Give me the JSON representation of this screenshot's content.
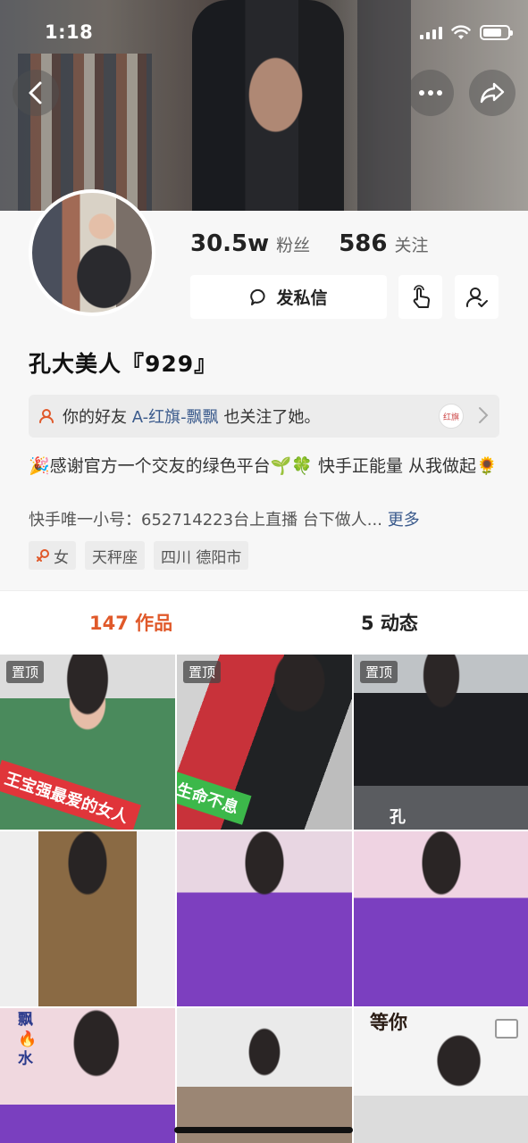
{
  "status_bar": {
    "time": "1:18"
  },
  "profile": {
    "followers_count": "30.5w",
    "followers_label": "粉丝",
    "following_count": "586",
    "following_label": "关注",
    "message_button": "发私信",
    "name": "孔大美人『929』",
    "friend_notice": {
      "prefix": "你的好友",
      "friend_name": "A-红旗-飘飘",
      "suffix": "也关注了她。",
      "badge_text": "红旗"
    },
    "bio_line1": "🎉感谢官方一个交友的绿色平台🌱🍀 快手正能量 从我做起🌻",
    "bio_line2": "快手唯一小号：652714223台上直播 台下做人...",
    "bio_more": "更多",
    "tags": [
      "女",
      "天秤座",
      "四川 德阳市"
    ]
  },
  "tabs": {
    "works": "147 作品",
    "moments": "5 动态"
  },
  "grid": {
    "pinned_label": "置顶",
    "items": [
      {
        "pinned": true,
        "caption": "王宝强最爱的女人"
      },
      {
        "pinned": true,
        "caption": "生命不息"
      },
      {
        "pinned": true,
        "caption": "孔"
      },
      {
        "pinned": false,
        "caption": ""
      },
      {
        "pinned": false,
        "caption": ""
      },
      {
        "pinned": false,
        "caption": ""
      },
      {
        "pinned": false,
        "caption": "飘🔥水"
      },
      {
        "pinned": false,
        "caption": ""
      },
      {
        "pinned": false,
        "caption": "等你"
      }
    ]
  },
  "colors": {
    "accent": "#e0592a",
    "link": "#3a5a8c",
    "panel_bg": "#f7f7f7"
  },
  "icons": [
    "back-arrow-icon",
    "more-dots-icon",
    "share-icon",
    "chat-bubble-icon",
    "tap-hand-icon",
    "follow-user-icon",
    "friend-link-icon",
    "chevron-right-icon",
    "female-icon",
    "image-placeholder-icon"
  ]
}
